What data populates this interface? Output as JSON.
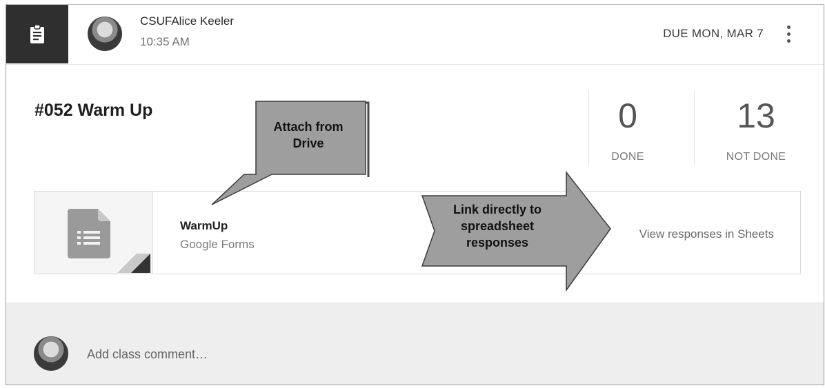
{
  "header": {
    "poster_name": "CSUFAlice Keeler",
    "post_time": "10:35 AM",
    "due_date": "DUE MON, MAR 7",
    "assignment_icon": "assignment-clipboard-icon",
    "more_icon": "more-vert-icon"
  },
  "assignment": {
    "title": "#052 Warm Up"
  },
  "stats": {
    "done_count": "0",
    "done_label": "DONE",
    "not_done_count": "13",
    "not_done_label": "NOT DONE"
  },
  "attachment": {
    "name": "WarmUp",
    "type": "Google Forms",
    "action_label": "View responses in Sheets",
    "icon": "google-forms-icon"
  },
  "callouts": {
    "attach": [
      "Attach from",
      "Drive"
    ],
    "link": [
      "Link directly to",
      "spreadsheet",
      "responses"
    ]
  },
  "comment": {
    "placeholder": "Add class comment…"
  }
}
